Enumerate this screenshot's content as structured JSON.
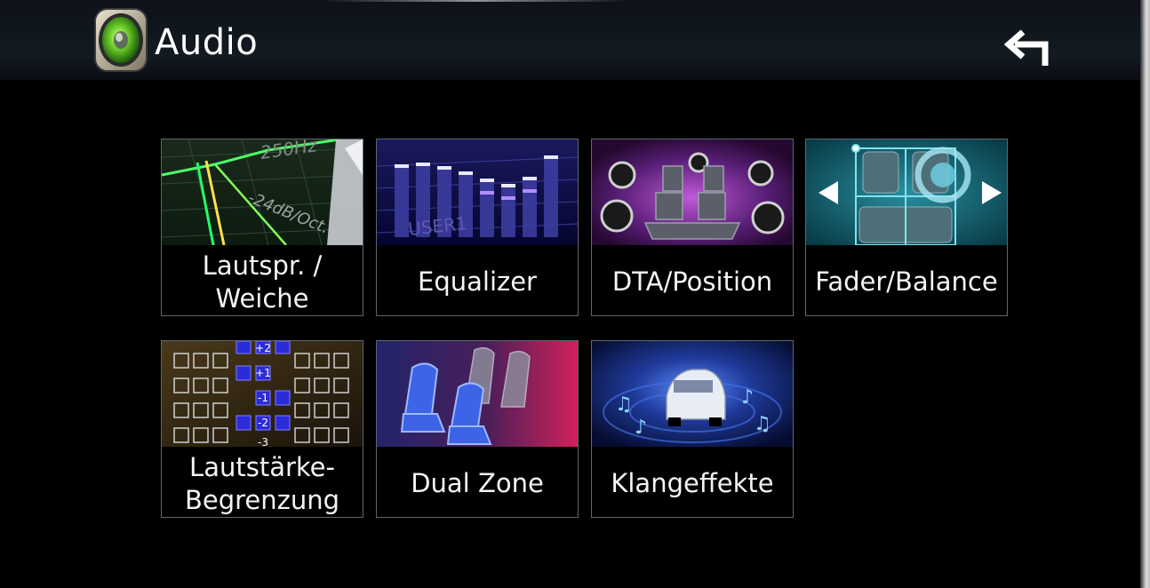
{
  "header": {
    "title": "Audio",
    "app_icon": "speaker-icon",
    "back_icon": "return-arrow-icon"
  },
  "tiles": [
    {
      "label_lines": [
        "Lautspr. /",
        "Weiche"
      ],
      "image": "crossover-graph-thumbnail",
      "annotation_freq": "250Hz",
      "annotation_slope": "-24dB/Oct."
    },
    {
      "label_lines": [
        "Equalizer"
      ],
      "image": "equalizer-bars-thumbnail",
      "annotation_preset": "USER1"
    },
    {
      "label_lines": [
        "DTA/Position"
      ],
      "image": "speaker-position-thumbnail"
    },
    {
      "label_lines": [
        "Fader/Balance"
      ],
      "image": "fader-balance-thumbnail"
    },
    {
      "label_lines": [
        "Lautstärke-",
        "Begrenzung"
      ],
      "image": "volume-offset-grid-thumbnail",
      "annotation_values": [
        "+2",
        "+1",
        "-1",
        "-2",
        "-3"
      ]
    },
    {
      "label_lines": [
        "Dual Zone"
      ],
      "image": "dual-zone-seats-thumbnail"
    },
    {
      "label_lines": [
        "Klangeffekte"
      ],
      "image": "sound-effects-car-thumbnail"
    }
  ]
}
